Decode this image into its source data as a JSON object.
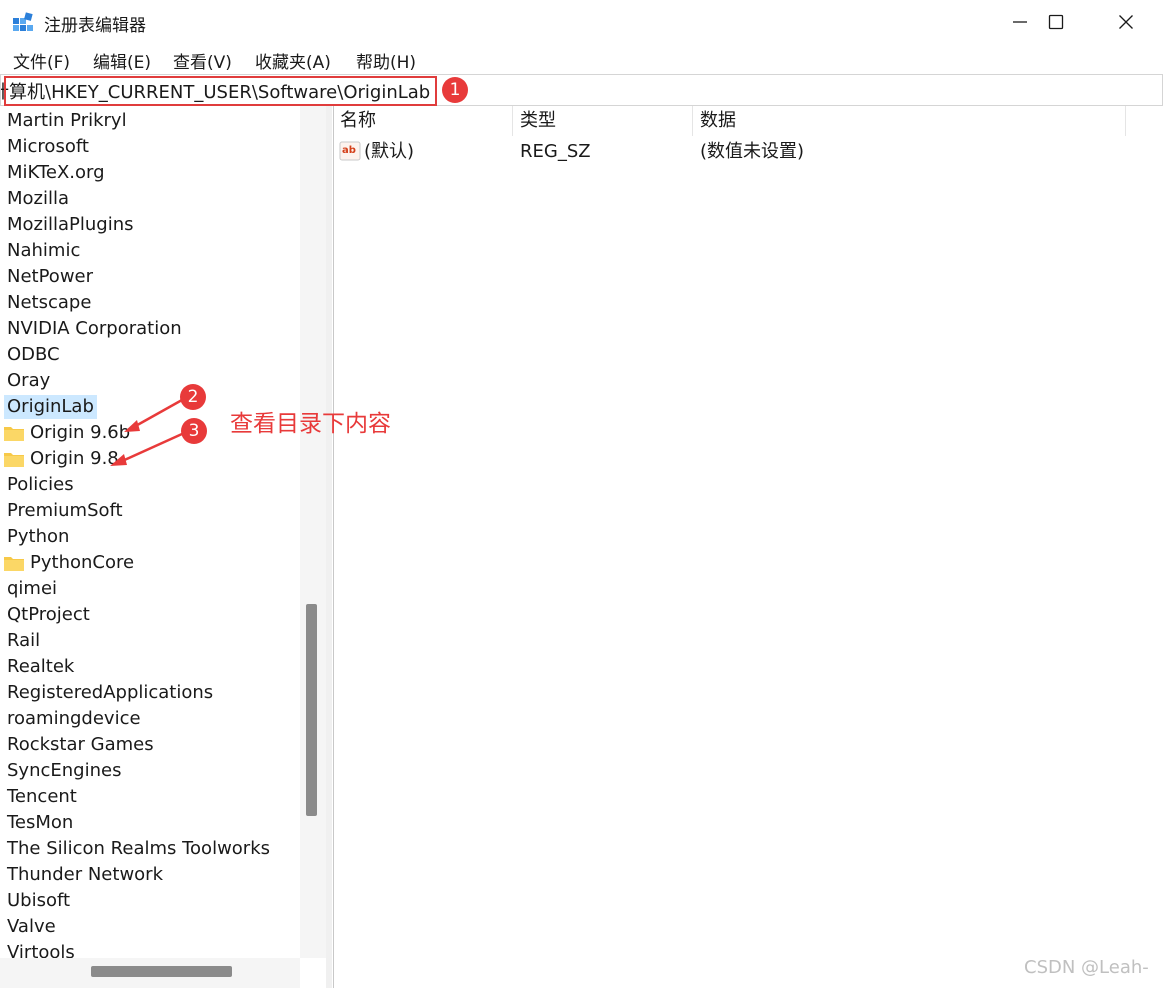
{
  "window": {
    "title": "注册表编辑器",
    "controls": {
      "minimize": "—",
      "maximize": "☐",
      "close": "✕"
    }
  },
  "menu": [
    "文件(F)",
    "编辑(E)",
    "查看(V)",
    "收藏夹(A)",
    "帮助(H)"
  ],
  "address": {
    "path": "计算机\\HKEY_CURRENT_USER\\Software\\OriginLab"
  },
  "tree": {
    "items": [
      {
        "label": "Martin Prikryl"
      },
      {
        "label": "Microsoft"
      },
      {
        "label": "MiKTeX.org"
      },
      {
        "label": "Mozilla"
      },
      {
        "label": "MozillaPlugins"
      },
      {
        "label": "Nahimic"
      },
      {
        "label": "NetPower"
      },
      {
        "label": "Netscape"
      },
      {
        "label": "NVIDIA Corporation"
      },
      {
        "label": "ODBC"
      },
      {
        "label": "Oray"
      },
      {
        "label": "OriginLab",
        "selected": true
      },
      {
        "label": "Origin 9.6b",
        "folder": true
      },
      {
        "label": "Origin 9.8",
        "folder": true
      },
      {
        "label": "Policies"
      },
      {
        "label": "PremiumSoft"
      },
      {
        "label": "Python"
      },
      {
        "label": "PythonCore",
        "folder": true
      },
      {
        "label": "qimei"
      },
      {
        "label": "QtProject"
      },
      {
        "label": "Rail"
      },
      {
        "label": "Realtek"
      },
      {
        "label": "RegisteredApplications"
      },
      {
        "label": "roamingdevice"
      },
      {
        "label": "Rockstar Games"
      },
      {
        "label": "SyncEngines"
      },
      {
        "label": "Tencent"
      },
      {
        "label": "TesMon"
      },
      {
        "label": "The Silicon Realms Toolworks"
      },
      {
        "label": "Thunder Network"
      },
      {
        "label": "Ubisoft"
      },
      {
        "label": "Valve"
      },
      {
        "label": "Virtools"
      }
    ]
  },
  "list": {
    "columns": [
      "名称",
      "类型",
      "数据"
    ],
    "rows": [
      {
        "name": "(默认)",
        "type": "REG_SZ",
        "data": "(数值未设置)",
        "icon": "string-value-icon"
      }
    ]
  },
  "annotations": {
    "badges": [
      "1",
      "2",
      "3"
    ],
    "note": "查看目录下内容",
    "color": "#e83a3a"
  },
  "watermark": "CSDN @Leah-"
}
